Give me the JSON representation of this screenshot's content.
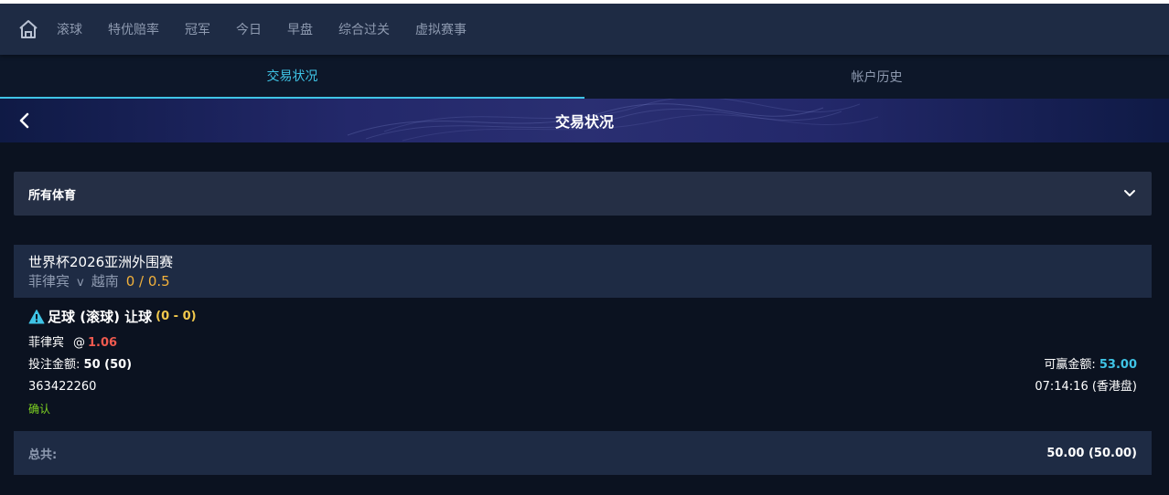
{
  "topnav": {
    "home_icon": "home-icon",
    "items": [
      "滚球",
      "特优赔率",
      "冠军",
      "今日",
      "早盘",
      "综合过关",
      "虚拟赛事"
    ]
  },
  "tabs": [
    {
      "label": "交易状况",
      "active": true
    },
    {
      "label": "帐户历史",
      "active": false
    }
  ],
  "banner": {
    "back_icon": "chevron-left-icon",
    "title": "交易状况"
  },
  "sport_filter": {
    "selected": "所有体育",
    "icon": "chevron-down-icon"
  },
  "bet": {
    "league": "世界杯2026亚洲外围赛",
    "home_team": "菲律宾",
    "vs": "v",
    "away_team": "越南",
    "handicap": "0 / 0.5",
    "bet_type": "足球 (滚球) 让球",
    "score": "(0 - 0)",
    "selection": "菲律宾",
    "at": "@",
    "odds": "1.06",
    "stake_label": "投注金额:",
    "stake_value": "50 (50)",
    "win_label": "可赢金额:",
    "win_value": "53.00",
    "ticket_id": "363422260",
    "time": "07:14:16 (香港盘)",
    "status": "确认"
  },
  "total": {
    "label": "总共:",
    "value": "50.00 (50.00)"
  },
  "colors": {
    "accent": "#3fc4e6",
    "odds": "#f05a4f",
    "handicap": "#f2b13b",
    "status": "#7ed321",
    "panel": "#1e2b44",
    "background": "#0b1220"
  }
}
